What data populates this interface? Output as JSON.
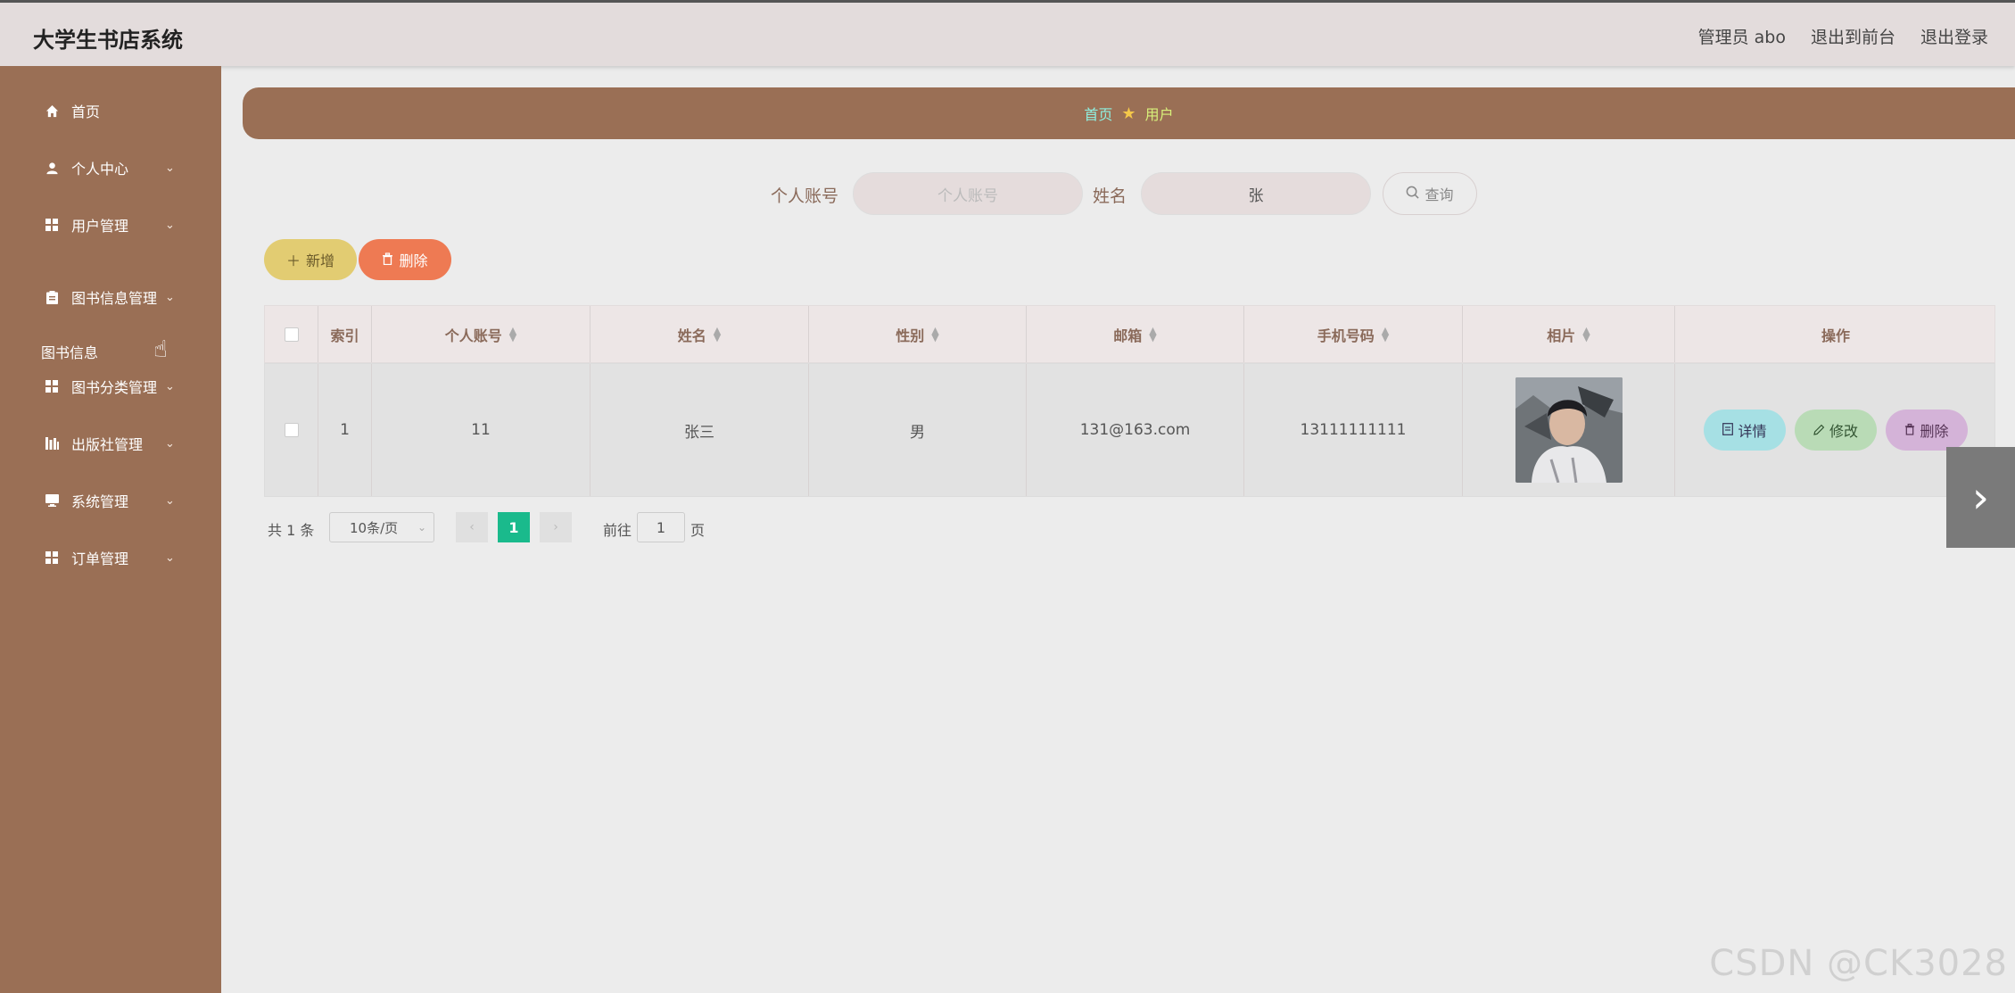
{
  "app": {
    "title": "大学生书店系统"
  },
  "header": {
    "user": "管理员 abo",
    "front": "退出到前台",
    "logout": "退出登录"
  },
  "sidebar": {
    "items": [
      {
        "label": "首页",
        "icon": "home-icon"
      },
      {
        "label": "个人中心",
        "icon": "user-icon"
      },
      {
        "label": "用户管理",
        "icon": "grid-icon"
      },
      {
        "label": "图书信息管理",
        "icon": "clipboard-icon"
      },
      {
        "label": "图书分类管理",
        "icon": "grid-icon"
      },
      {
        "label": "出版社管理",
        "icon": "bars-icon"
      },
      {
        "label": "系统管理",
        "icon": "monitor-icon"
      },
      {
        "label": "订单管理",
        "icon": "grid-icon"
      }
    ],
    "sub_item": "图书信息"
  },
  "breadcrumb": {
    "home": "首页",
    "current": "用户"
  },
  "search": {
    "account_label": "个人账号",
    "account_placeholder": "个人账号",
    "name_label": "姓名",
    "name_value": "张",
    "button": "查询"
  },
  "actions": {
    "add": "新增",
    "delete": "删除"
  },
  "table": {
    "headers": [
      "索引",
      "个人账号",
      "姓名",
      "性别",
      "邮箱",
      "手机号码",
      "相片",
      "操作"
    ],
    "rows": [
      {
        "index": "1",
        "account": "11",
        "name": "张三",
        "gender": "男",
        "email": "131@163.com",
        "phone": "13111111111"
      }
    ],
    "ops": {
      "detail": "详情",
      "edit": "修改",
      "delete": "删除"
    }
  },
  "pager": {
    "total": "共 1 条",
    "size": "10条/页",
    "current": "1",
    "goto": "前往",
    "goto_value": "1",
    "unit": "页"
  },
  "watermark": "CSDN @CK3028",
  "colors": {
    "sidebar": "#9a6f55",
    "topbar": "#e3dcdc",
    "page_active": "#1aba8c"
  }
}
